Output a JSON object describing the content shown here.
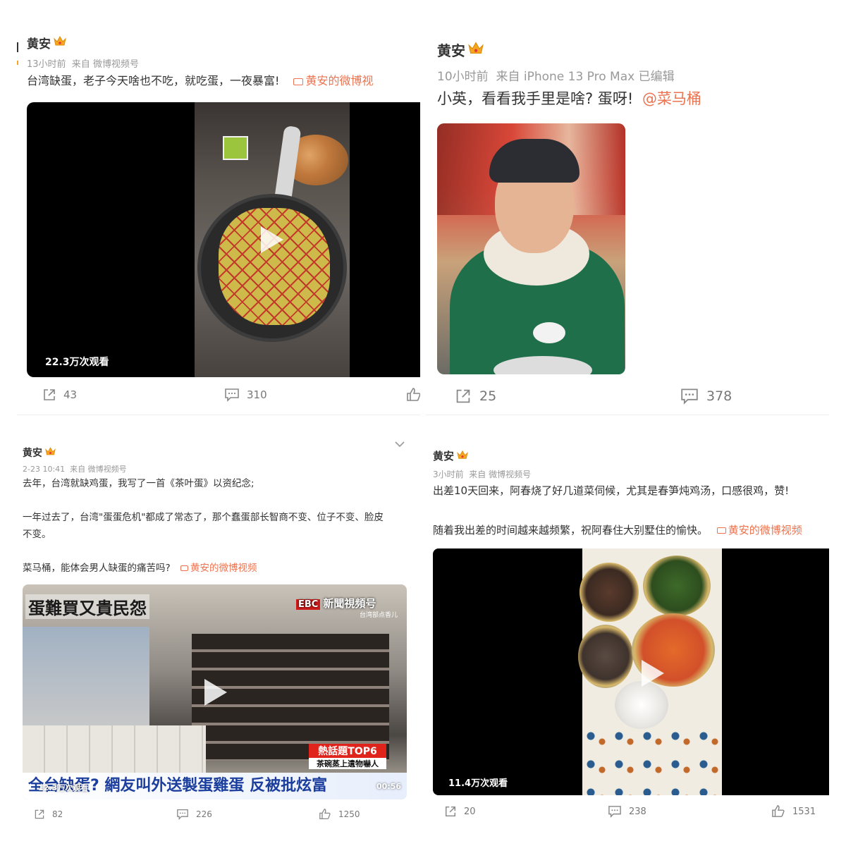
{
  "posts": [
    {
      "author": "黄安",
      "meta": "13小时前  来自 微博视频号",
      "text": "台湾缺蛋，老子今天啥也不吃，就吃蛋，一夜暴富!",
      "link": "黄安的微博视",
      "views": "22.3万次观看",
      "share": "43",
      "comment": "310"
    },
    {
      "author": "黄安",
      "meta": "10小时前  来自 iPhone 13 Pro Max 已编辑",
      "text": "小英，看看我手里是啥? 蛋呀!",
      "mention": "@菜马桶",
      "share": "25",
      "comment": "378"
    },
    {
      "author": "黄安",
      "meta": "2-23 10:41  来自 微博视频号",
      "text_lines": [
        "去年，台湾就缺鸡蛋，我写了一首《茶叶蛋》以资纪念;",
        "一年过去了，台湾\"蛋蛋危机\"都成了常态了，那个蠢蛋部长智商不变、位子不变、脸皮",
        "不变。",
        "菜马桶，能体会男人缺蛋的痛苦吗?"
      ],
      "link": "黄安的微博视频",
      "video_headline": "蛋難買又貴民怨",
      "video_logo": "新聞視頻号",
      "video_sub": "台湾部点香儿",
      "video_badge": "熱話題TOP6",
      "video_badge_sub": "茶碗蒸上遺物嚇人",
      "video_caption": "全台缺蛋? 網友叫外送製蛋雞蛋 反被批炫富",
      "views": "12.3万次观看",
      "duration": "00:56",
      "share": "82",
      "comment": "226",
      "like": "1250"
    },
    {
      "author": "黄安",
      "meta": "3小时前  来自 微博视频号",
      "text_lines": [
        "出差10天回来，阿春烧了好几道菜伺候，尤其是春笋炖鸡汤，口感很鸡，赞!",
        "随着我出差的时间越来越频繁，祝阿春住大别墅住的愉快。"
      ],
      "link": "黄安的微博视频",
      "views": "11.4万次观看",
      "share": "20",
      "comment": "238",
      "like": "1531"
    }
  ],
  "colors": {
    "link": "#eb7350",
    "crown": "#f5a623",
    "meta": "#999999",
    "icon": "#888888"
  }
}
